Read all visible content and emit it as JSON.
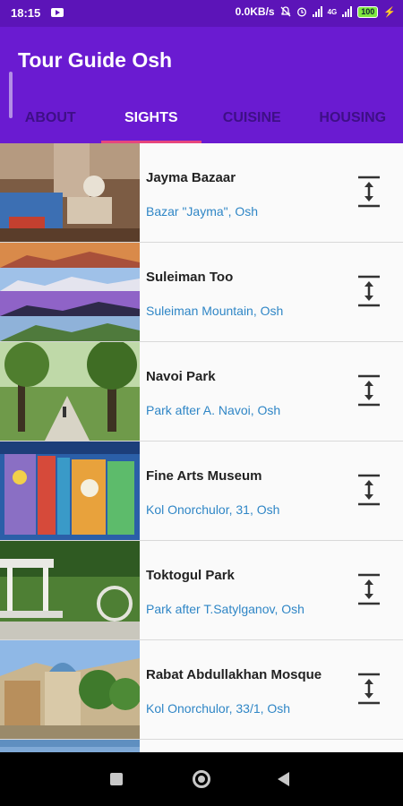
{
  "status": {
    "time": "18:15",
    "speed": "0.0KB/s",
    "lte": "4G",
    "battery": "100"
  },
  "app": {
    "title": "Tour Guide Osh"
  },
  "tabs": [
    {
      "label": "ABOUT",
      "active": false
    },
    {
      "label": "SIGHTS",
      "active": true
    },
    {
      "label": "CUISINE",
      "active": false
    },
    {
      "label": "HOUSING",
      "active": false
    }
  ],
  "sights": [
    {
      "name": "Jayma Bazaar",
      "address": "Bazar \"Jayma\", Osh"
    },
    {
      "name": "Suleiman Too",
      "address": "Suleiman Mountain, Osh"
    },
    {
      "name": "Navoi Park",
      "address": "Park after A. Navoi, Osh"
    },
    {
      "name": "Fine Arts Museum",
      "address": "Kol Onorchulor, 31, Osh"
    },
    {
      "name": "Toktogul Park",
      "address": "Park after T.Satylganov, Osh"
    },
    {
      "name": "Rabat Abdullakhan Mosque",
      "address": "Kol Onorchulor, 33/1, Osh"
    }
  ],
  "colors": {
    "statusbar": "#5c14b8",
    "appbar": "#6a1bd1",
    "indicator": "#e6467d",
    "address": "#2f86c6"
  },
  "icons": {
    "sort": "vertical-arrows-icon"
  }
}
